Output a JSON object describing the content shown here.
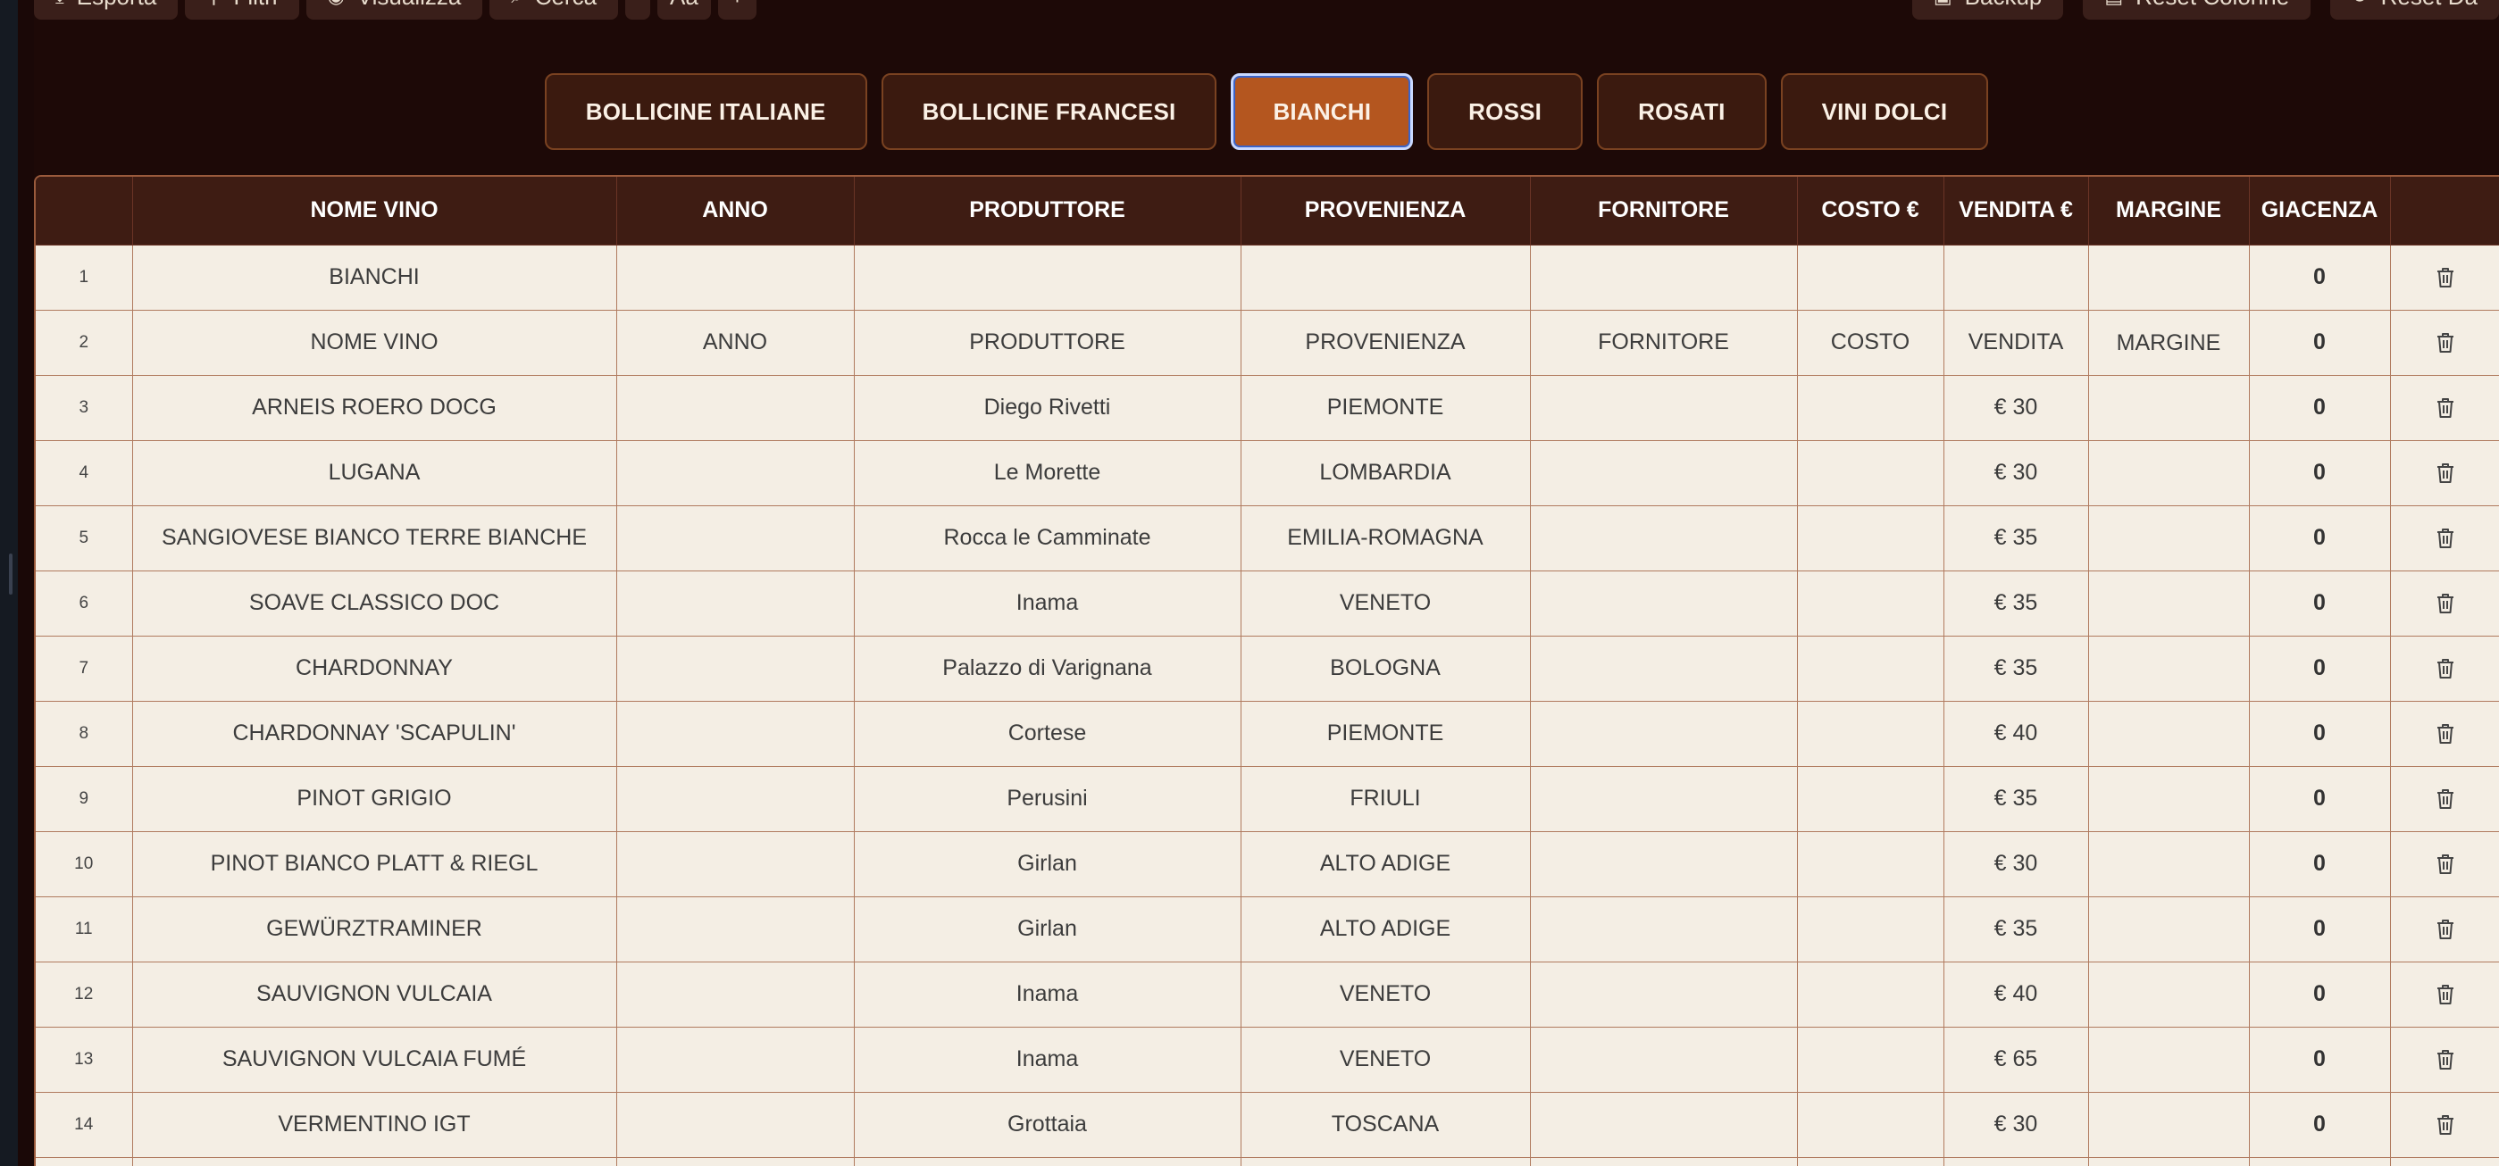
{
  "toolbar": {
    "left": [
      {
        "label": "Esporta",
        "icon": "download-icon"
      },
      {
        "label": "Filtri",
        "icon": "filter-icon"
      },
      {
        "label": "Visualizza",
        "icon": "eye-icon"
      },
      {
        "label": "Cerca",
        "icon": "search-icon"
      }
    ],
    "font_size_label": "Aa",
    "font_plus_label": "+",
    "right": [
      {
        "label": "Backup",
        "icon": "save-icon"
      },
      {
        "label": "Reset Colonne",
        "icon": "columns-icon"
      },
      {
        "label": "Reset Da",
        "icon": "reset-icon"
      }
    ]
  },
  "categories": [
    {
      "label": "BOLLICINE ITALIANE",
      "active": false
    },
    {
      "label": "BOLLICINE FRANCESI",
      "active": false
    },
    {
      "label": "BIANCHI",
      "active": true
    },
    {
      "label": "ROSSI",
      "active": false
    },
    {
      "label": "ROSATI",
      "active": false
    },
    {
      "label": "VINI DOLCI",
      "active": false
    }
  ],
  "colors": {
    "background": "#1d0907",
    "header_bg": "#3e1c13",
    "tab_bg": "#3b1a0f",
    "tab_active": "#b4561f",
    "cell_bg": "#f4eee4",
    "cell_border": "#b07a5e"
  },
  "table": {
    "headers": [
      "",
      "NOME VINO",
      "ANNO",
      "PRODUTTORE",
      "PROVENIENZA",
      "FORNITORE",
      "COSTO €",
      "VENDITA €",
      "MARGINE",
      "GIACENZA",
      ""
    ],
    "rows": [
      {
        "n": "1",
        "nome": "BIANCHI",
        "anno": "",
        "produttore": "",
        "provenienza": "",
        "fornitore": "",
        "costo": "",
        "vendita": "",
        "margine": "",
        "giacenza": "0"
      },
      {
        "n": "2",
        "nome": "NOME VINO",
        "anno": "ANNO",
        "produttore": "PRODUTTORE",
        "provenienza": "PROVENIENZA",
        "fornitore": "FORNITORE",
        "costo": "COSTO",
        "vendita": "VENDITA",
        "margine": "MARGINE",
        "giacenza": "0"
      },
      {
        "n": "3",
        "nome": "ARNEIS ROERO DOCG",
        "anno": "",
        "produttore": "Diego Rivetti",
        "provenienza": "PIEMONTE",
        "fornitore": "",
        "costo": "",
        "vendita": "€ 30",
        "margine": "",
        "giacenza": "0"
      },
      {
        "n": "4",
        "nome": "LUGANA",
        "anno": "",
        "produttore": "Le Morette",
        "provenienza": "LOMBARDIA",
        "fornitore": "",
        "costo": "",
        "vendita": "€ 30",
        "margine": "",
        "giacenza": "0"
      },
      {
        "n": "5",
        "nome": "SANGIOVESE BIANCO TERRE BIANCHE",
        "anno": "",
        "produttore": "Rocca le Camminate",
        "provenienza": "EMILIA-ROMAGNA",
        "fornitore": "",
        "costo": "",
        "vendita": "€ 35",
        "margine": "",
        "giacenza": "0"
      },
      {
        "n": "6",
        "nome": "SOAVE CLASSICO DOC",
        "anno": "",
        "produttore": "Inama",
        "provenienza": "VENETO",
        "fornitore": "",
        "costo": "",
        "vendita": "€ 35",
        "margine": "",
        "giacenza": "0"
      },
      {
        "n": "7",
        "nome": "CHARDONNAY",
        "anno": "",
        "produttore": "Palazzo di Varignana",
        "provenienza": "BOLOGNA",
        "fornitore": "",
        "costo": "",
        "vendita": "€ 35",
        "margine": "",
        "giacenza": "0"
      },
      {
        "n": "8",
        "nome": "CHARDONNAY 'SCAPULIN'",
        "anno": "",
        "produttore": "Cortese",
        "provenienza": "PIEMONTE",
        "fornitore": "",
        "costo": "",
        "vendita": "€ 40",
        "margine": "",
        "giacenza": "0"
      },
      {
        "n": "9",
        "nome": "PINOT GRIGIO",
        "anno": "",
        "produttore": "Perusini",
        "provenienza": "FRIULI",
        "fornitore": "",
        "costo": "",
        "vendita": "€ 35",
        "margine": "",
        "giacenza": "0"
      },
      {
        "n": "10",
        "nome": "PINOT BIANCO PLATT & RIEGL",
        "anno": "",
        "produttore": "Girlan",
        "provenienza": "ALTO ADIGE",
        "fornitore": "",
        "costo": "",
        "vendita": "€ 30",
        "margine": "",
        "giacenza": "0"
      },
      {
        "n": "11",
        "nome": "GEWÜRZTRAMINER",
        "anno": "",
        "produttore": "Girlan",
        "provenienza": "ALTO ADIGE",
        "fornitore": "",
        "costo": "",
        "vendita": "€ 35",
        "margine": "",
        "giacenza": "0"
      },
      {
        "n": "12",
        "nome": "SAUVIGNON VULCAIA",
        "anno": "",
        "produttore": "Inama",
        "provenienza": "VENETO",
        "fornitore": "",
        "costo": "",
        "vendita": "€ 40",
        "margine": "",
        "giacenza": "0"
      },
      {
        "n": "13",
        "nome": "SAUVIGNON VULCAIA FUMÉ",
        "anno": "",
        "produttore": "Inama",
        "provenienza": "VENETO",
        "fornitore": "",
        "costo": "",
        "vendita": "€ 65",
        "margine": "",
        "giacenza": "0"
      },
      {
        "n": "14",
        "nome": "VERMENTINO IGT",
        "anno": "",
        "produttore": "Grottaia",
        "provenienza": "TOSCANA",
        "fornitore": "",
        "costo": "",
        "vendita": "€ 30",
        "margine": "",
        "giacenza": "0"
      },
      {
        "n": "",
        "nome": "",
        "anno": "",
        "produttore": "",
        "provenienza": "",
        "fornitore": "",
        "costo": "",
        "vendita": "",
        "margine": "",
        "giacenza": ""
      }
    ]
  }
}
